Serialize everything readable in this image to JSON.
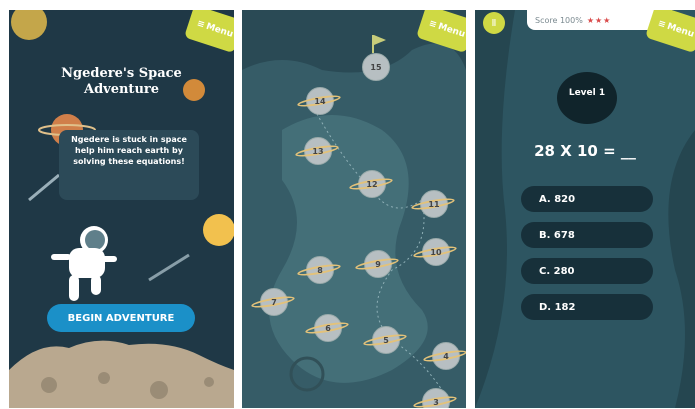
{
  "common": {
    "menu_label": "Menu"
  },
  "intro": {
    "title_line1": "Ngedere's Space",
    "title_line2": "Adventure",
    "description": "Ngedere is stuck in space help him reach earth by solving these equations!",
    "cta_label": "BEGIN ADVENTURE"
  },
  "map": {
    "levels": [
      "14",
      "13",
      "12",
      "11",
      "10",
      "9",
      "8",
      "7",
      "6",
      "5",
      "4",
      "3",
      "15"
    ]
  },
  "quiz": {
    "score_label": "Score 100%",
    "score_stars": "★★★",
    "level_label": "Level 1",
    "question": "28 X 10 = __",
    "answers": [
      {
        "label": "A. 820"
      },
      {
        "label": "B. 678"
      },
      {
        "label": "C. 280"
      },
      {
        "label": "D. 182"
      }
    ]
  },
  "colors": {
    "menu": "#cfd944",
    "cta": "#1b90c8",
    "answer_bg": "#17303a",
    "panel_dark": "#1f3846"
  }
}
